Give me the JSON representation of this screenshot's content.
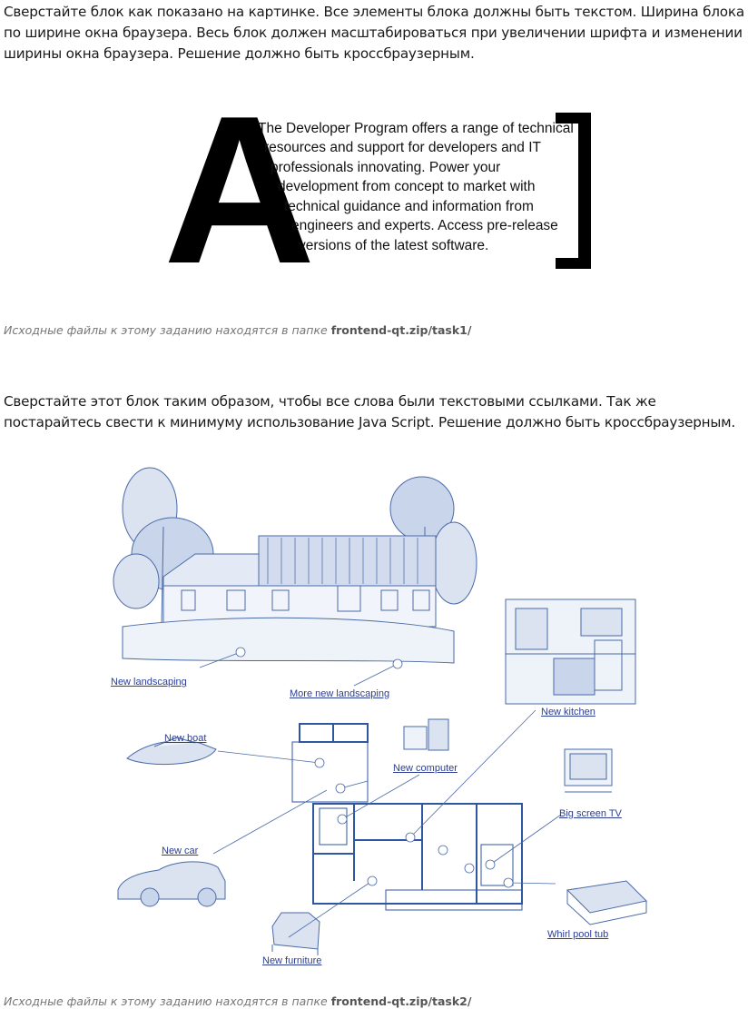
{
  "task1": {
    "instructions": "Сверстайте блок как показано на картинке. Все элементы блока должны быть текстом. Ширина блока по ширине окна браузера. Весь блок должен масштабироваться при увеличении шрифта и изменении ширины окна браузера. Решение должно быть кроссбраузерным.",
    "drop_cap": "A",
    "lines": [
      "The Developer Program offers a range of technical",
      "resources and support for developers and IT",
      "professionals innovating. Power your",
      "development from concept to market with",
      "technical guidance and information from",
      "engineers and experts. Access pre-release",
      "versions of the latest software."
    ],
    "source_prefix": "Исходные файлы к этому заданию находятся в папке ",
    "source_path": "frontend-qt.zip/task1/"
  },
  "task2": {
    "instructions": "Сверстайте этот блок таким образом, чтобы все слова были текстовыми ссылками. Так же постарайтесь свести к минимуму использование Java Script. Решение должно быть кроссбраузерным.",
    "links": {
      "new_landscaping": "New landscaping",
      "more_new_landscaping": "More new landscaping",
      "new_kitchen": "New kitchen",
      "new_boat": "New boat",
      "new_computer": "New computer",
      "big_screen_tv": "Big screen TV",
      "new_car": "New car",
      "whirl_pool_tub": "Whirl pool tub",
      "new_furniture": "New furniture"
    },
    "source_prefix": "Исходные файлы к этому заданию находятся в папке ",
    "source_path": "frontend-qt.zip/task2/"
  },
  "colors": {
    "link": "#2b3e94",
    "sketch": "#4a6aa8",
    "text": "#1a1a1a",
    "muted": "#777777"
  }
}
